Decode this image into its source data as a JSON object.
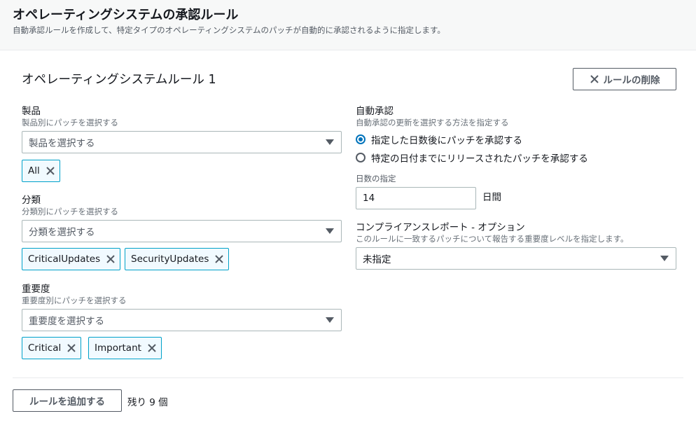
{
  "header": {
    "title": "オペレーティングシステムの承認ルール",
    "description": "自動承認ルールを作成して、特定タイプのオペレーティングシステムのパッチが自動的に承認されるように指定します。"
  },
  "rule": {
    "title": "オペレーティングシステムルール 1",
    "delete_label": "ルールの削除"
  },
  "product": {
    "label": "製品",
    "description": "製品別にパッチを選択する",
    "placeholder": "製品を選択する",
    "tokens": [
      "All"
    ]
  },
  "classification": {
    "label": "分類",
    "description": "分類別にパッチを選択する",
    "placeholder": "分類を選択する",
    "tokens": [
      "CriticalUpdates",
      "SecurityUpdates"
    ]
  },
  "severity": {
    "label": "重要度",
    "description": "重要度別にパッチを選択する",
    "placeholder": "重要度を選択する",
    "tokens": [
      "Critical",
      "Important"
    ]
  },
  "auto_approval": {
    "label": "自動承認",
    "description": "自動承認の更新を選択する方法を指定する",
    "options": [
      {
        "label": "指定した日数後にパッチを承認する",
        "checked": true
      },
      {
        "label": "特定の日付までにリリースされたパッチを承認する",
        "checked": false
      }
    ],
    "days_label": "日数の指定",
    "days_value": "14",
    "days_unit": "日間"
  },
  "compliance": {
    "label": "コンプライアンスレポート - オプション",
    "description": "このルールに一致するパッチについて報告する重要度レベルを指定します。",
    "selected": "未指定"
  },
  "footer": {
    "add_rule_label": "ルールを追加する",
    "remaining": "残り 9 個"
  },
  "colors": {
    "token_border": "#00a1c9",
    "token_bg": "#f1faff",
    "radio_accent": "#0073bb",
    "header_bg": "#f7f8f8"
  }
}
